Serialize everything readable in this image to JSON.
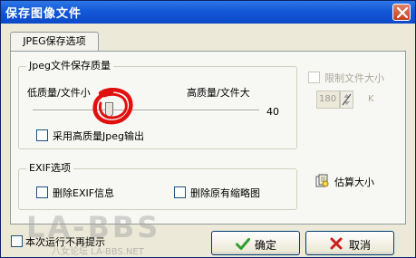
{
  "window": {
    "title": "保存图像文件"
  },
  "tabs": [
    {
      "label": "JPEG保存选项"
    }
  ],
  "quality": {
    "group_title": "Jpeg文件保存质量",
    "low_label": "低质量/文件小",
    "high_label": "高质量/文件大",
    "slider_value": "40",
    "hq_checkbox_label": "采用高质量Jpeg输出"
  },
  "size_limit": {
    "checkbox_label": "限制文件大小",
    "value": "180",
    "unit": "K"
  },
  "exif": {
    "group_title": "EXIF选项",
    "remove_exif_label": "删除EXIF信息",
    "remove_thumb_label": "删除原有缩略图"
  },
  "estimate_label": "估算大小",
  "footer": {
    "no_show_label": "本次运行不再提示",
    "ok_label": "确定",
    "cancel_label": "取消"
  },
  "watermark": {
    "big": "LA-BBS",
    "small": "八女论坛 LA-BBS.NET"
  },
  "colors": {
    "titlebar": "#0b49c8",
    "dialog_bg": "#ece9d8",
    "panel_bg": "#f7f7f4",
    "ok_check": "#2e9e2e",
    "cancel_x": "#cc1f1f",
    "annotation": "#e01010"
  }
}
